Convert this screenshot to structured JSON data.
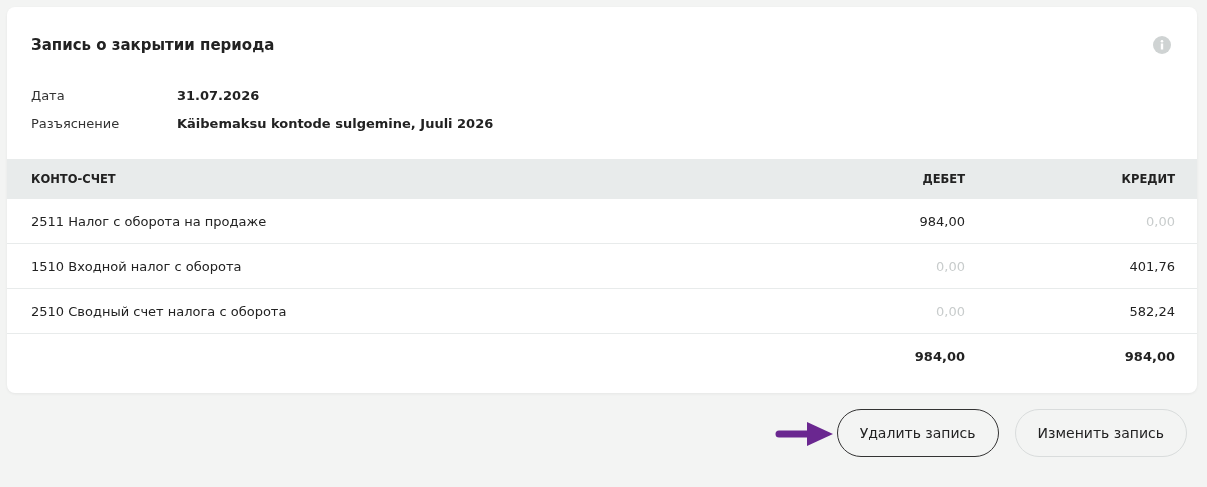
{
  "card": {
    "title": "Запись о закрытии периода",
    "details": [
      {
        "label": "Дата",
        "value": "31.07.2026"
      },
      {
        "label": "Разъяснение",
        "value": "Käibemaksu kontode sulgemine, Juuli 2026"
      }
    ]
  },
  "table": {
    "columns": [
      "КОНТО-СЧЕТ",
      "ДЕБЕТ",
      "КРЕДИТ"
    ],
    "rows": [
      {
        "account": "2511 Налог с оборота на продаже",
        "debit": {
          "text": "984,00",
          "dimmed": false
        },
        "credit": {
          "text": "0,00",
          "dimmed": true
        }
      },
      {
        "account": "1510 Входной налог с оборота",
        "debit": {
          "text": "0,00",
          "dimmed": true
        },
        "credit": {
          "text": "401,76",
          "dimmed": false
        }
      },
      {
        "account": "2510 Сводный счет налога с оборота",
        "debit": {
          "text": "0,00",
          "dimmed": true
        },
        "credit": {
          "text": "582,24",
          "dimmed": false
        }
      }
    ],
    "totals": {
      "debit": "984,00",
      "credit": "984,00"
    }
  },
  "buttons": [
    {
      "label": "Удалить запись",
      "focused": true,
      "pointed": true
    },
    {
      "label": "Изменить запись",
      "focused": false,
      "pointed": false
    }
  ]
}
